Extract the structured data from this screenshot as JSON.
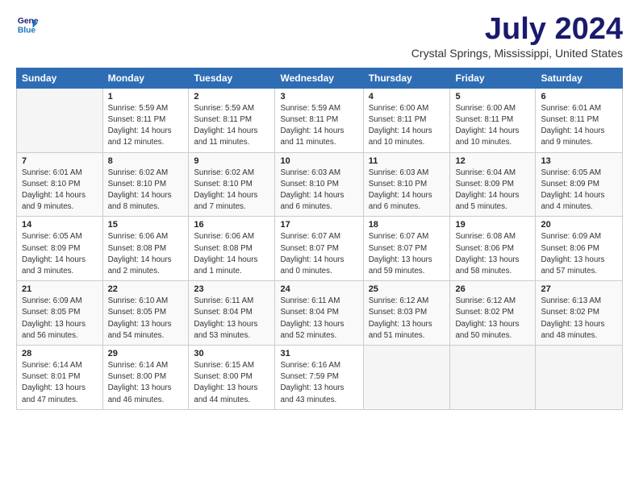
{
  "header": {
    "logo_line1": "General",
    "logo_line2": "Blue",
    "month_title": "July 2024",
    "location": "Crystal Springs, Mississippi, United States"
  },
  "days_of_week": [
    "Sunday",
    "Monday",
    "Tuesday",
    "Wednesday",
    "Thursday",
    "Friday",
    "Saturday"
  ],
  "weeks": [
    [
      {
        "day": "",
        "info": ""
      },
      {
        "day": "1",
        "info": "Sunrise: 5:59 AM\nSunset: 8:11 PM\nDaylight: 14 hours\nand 12 minutes."
      },
      {
        "day": "2",
        "info": "Sunrise: 5:59 AM\nSunset: 8:11 PM\nDaylight: 14 hours\nand 11 minutes."
      },
      {
        "day": "3",
        "info": "Sunrise: 5:59 AM\nSunset: 8:11 PM\nDaylight: 14 hours\nand 11 minutes."
      },
      {
        "day": "4",
        "info": "Sunrise: 6:00 AM\nSunset: 8:11 PM\nDaylight: 14 hours\nand 10 minutes."
      },
      {
        "day": "5",
        "info": "Sunrise: 6:00 AM\nSunset: 8:11 PM\nDaylight: 14 hours\nand 10 minutes."
      },
      {
        "day": "6",
        "info": "Sunrise: 6:01 AM\nSunset: 8:11 PM\nDaylight: 14 hours\nand 9 minutes."
      }
    ],
    [
      {
        "day": "7",
        "info": "Sunrise: 6:01 AM\nSunset: 8:10 PM\nDaylight: 14 hours\nand 9 minutes."
      },
      {
        "day": "8",
        "info": "Sunrise: 6:02 AM\nSunset: 8:10 PM\nDaylight: 14 hours\nand 8 minutes."
      },
      {
        "day": "9",
        "info": "Sunrise: 6:02 AM\nSunset: 8:10 PM\nDaylight: 14 hours\nand 7 minutes."
      },
      {
        "day": "10",
        "info": "Sunrise: 6:03 AM\nSunset: 8:10 PM\nDaylight: 14 hours\nand 6 minutes."
      },
      {
        "day": "11",
        "info": "Sunrise: 6:03 AM\nSunset: 8:10 PM\nDaylight: 14 hours\nand 6 minutes."
      },
      {
        "day": "12",
        "info": "Sunrise: 6:04 AM\nSunset: 8:09 PM\nDaylight: 14 hours\nand 5 minutes."
      },
      {
        "day": "13",
        "info": "Sunrise: 6:05 AM\nSunset: 8:09 PM\nDaylight: 14 hours\nand 4 minutes."
      }
    ],
    [
      {
        "day": "14",
        "info": "Sunrise: 6:05 AM\nSunset: 8:09 PM\nDaylight: 14 hours\nand 3 minutes."
      },
      {
        "day": "15",
        "info": "Sunrise: 6:06 AM\nSunset: 8:08 PM\nDaylight: 14 hours\nand 2 minutes."
      },
      {
        "day": "16",
        "info": "Sunrise: 6:06 AM\nSunset: 8:08 PM\nDaylight: 14 hours\nand 1 minute."
      },
      {
        "day": "17",
        "info": "Sunrise: 6:07 AM\nSunset: 8:07 PM\nDaylight: 14 hours\nand 0 minutes."
      },
      {
        "day": "18",
        "info": "Sunrise: 6:07 AM\nSunset: 8:07 PM\nDaylight: 13 hours\nand 59 minutes."
      },
      {
        "day": "19",
        "info": "Sunrise: 6:08 AM\nSunset: 8:06 PM\nDaylight: 13 hours\nand 58 minutes."
      },
      {
        "day": "20",
        "info": "Sunrise: 6:09 AM\nSunset: 8:06 PM\nDaylight: 13 hours\nand 57 minutes."
      }
    ],
    [
      {
        "day": "21",
        "info": "Sunrise: 6:09 AM\nSunset: 8:05 PM\nDaylight: 13 hours\nand 56 minutes."
      },
      {
        "day": "22",
        "info": "Sunrise: 6:10 AM\nSunset: 8:05 PM\nDaylight: 13 hours\nand 54 minutes."
      },
      {
        "day": "23",
        "info": "Sunrise: 6:11 AM\nSunset: 8:04 PM\nDaylight: 13 hours\nand 53 minutes."
      },
      {
        "day": "24",
        "info": "Sunrise: 6:11 AM\nSunset: 8:04 PM\nDaylight: 13 hours\nand 52 minutes."
      },
      {
        "day": "25",
        "info": "Sunrise: 6:12 AM\nSunset: 8:03 PM\nDaylight: 13 hours\nand 51 minutes."
      },
      {
        "day": "26",
        "info": "Sunrise: 6:12 AM\nSunset: 8:02 PM\nDaylight: 13 hours\nand 50 minutes."
      },
      {
        "day": "27",
        "info": "Sunrise: 6:13 AM\nSunset: 8:02 PM\nDaylight: 13 hours\nand 48 minutes."
      }
    ],
    [
      {
        "day": "28",
        "info": "Sunrise: 6:14 AM\nSunset: 8:01 PM\nDaylight: 13 hours\nand 47 minutes."
      },
      {
        "day": "29",
        "info": "Sunrise: 6:14 AM\nSunset: 8:00 PM\nDaylight: 13 hours\nand 46 minutes."
      },
      {
        "day": "30",
        "info": "Sunrise: 6:15 AM\nSunset: 8:00 PM\nDaylight: 13 hours\nand 44 minutes."
      },
      {
        "day": "31",
        "info": "Sunrise: 6:16 AM\nSunset: 7:59 PM\nDaylight: 13 hours\nand 43 minutes."
      },
      {
        "day": "",
        "info": ""
      },
      {
        "day": "",
        "info": ""
      },
      {
        "day": "",
        "info": ""
      }
    ]
  ]
}
